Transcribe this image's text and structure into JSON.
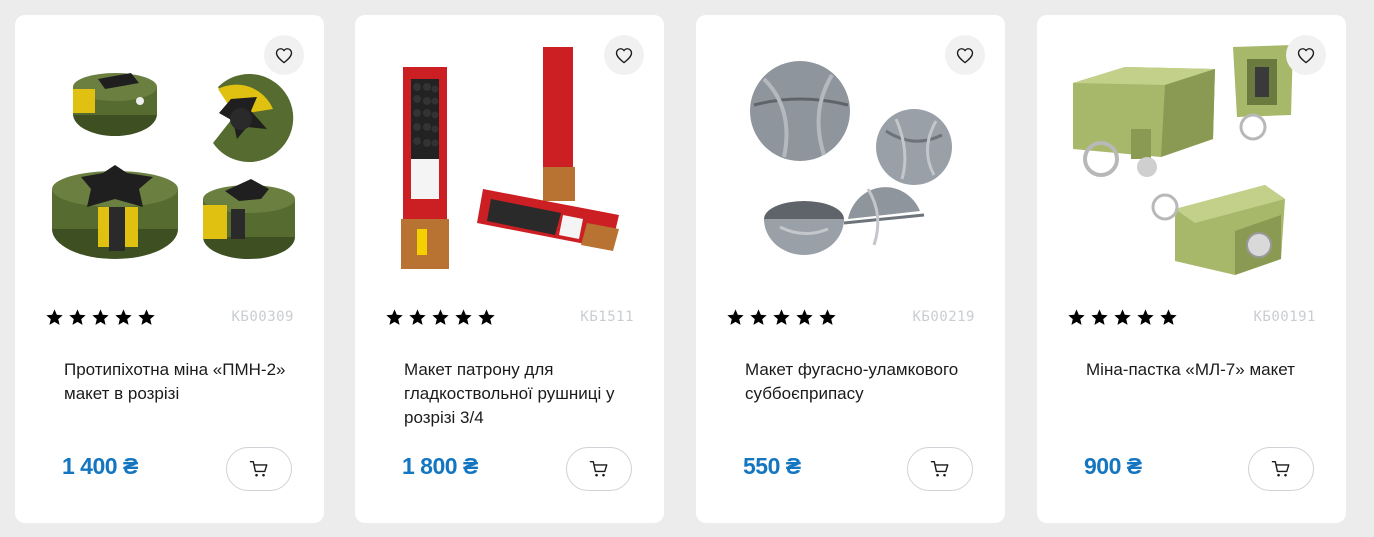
{
  "products": [
    {
      "sku": "КБ00309",
      "title": "Протипіхотна міна «ПМН-2» макет в розрізі",
      "price": "1 400 ₴",
      "rating": 5,
      "image_icon": "landmine-cutaway-model-icon",
      "colors": {
        "body": "#556b2f",
        "accent": "#e0c010"
      }
    },
    {
      "sku": "КБ1511",
      "title": "Макет патрону для гладкоствольної рушниці у розрізі 3/4",
      "price": "1 800 ₴",
      "rating": 5,
      "image_icon": "shotgun-shell-cutaway-icon",
      "colors": {
        "body": "#cc1f24",
        "accent": "#b87333"
      }
    },
    {
      "sku": "КБ00219",
      "title": "Макет фугасно-уламкового суббоєприпасу",
      "price": "550 ₴",
      "rating": 5,
      "image_icon": "submunition-sphere-model-icon",
      "colors": {
        "body": "#8f959c",
        "accent": "#6d737a"
      }
    },
    {
      "sku": "КБ00191",
      "title": "Міна-пастка «МЛ-7» макет",
      "price": "900 ₴",
      "rating": 5,
      "image_icon": "booby-trap-mine-model-icon",
      "colors": {
        "body": "#a7b86a",
        "accent": "#c0c0c0"
      }
    }
  ],
  "colors": {
    "price": "#1476c0",
    "star": "#000000",
    "sku": "#c9cdd2"
  }
}
